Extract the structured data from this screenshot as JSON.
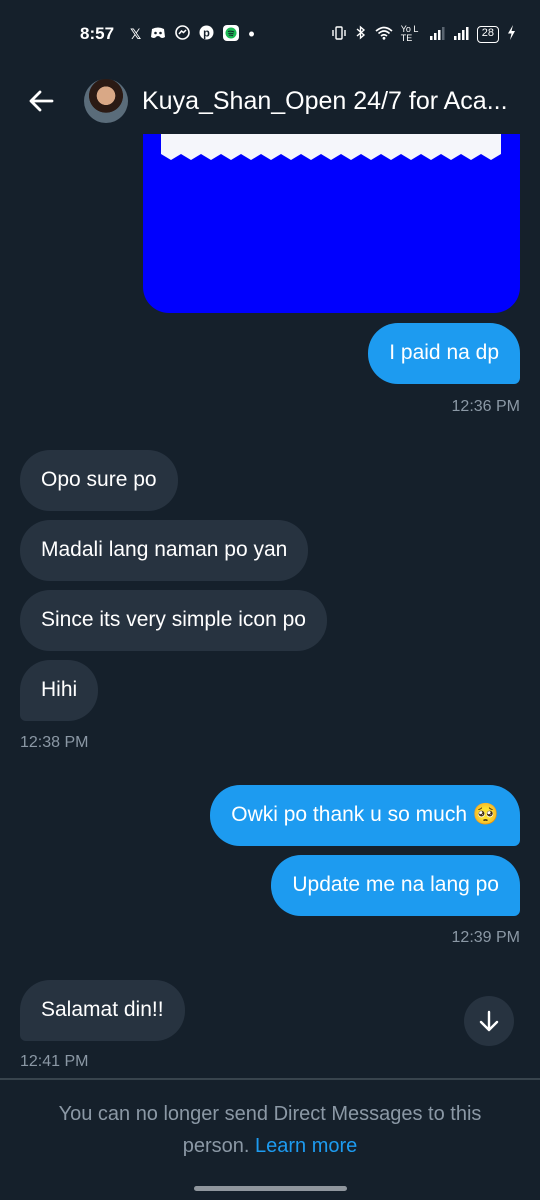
{
  "status_bar": {
    "time": "8:57",
    "left_icons": [
      "x-icon",
      "discord-icon",
      "messenger-icon",
      "pinterest-icon",
      "spotify-icon",
      "dot-icon"
    ],
    "network_label": "Yo LTE",
    "battery": "28"
  },
  "header": {
    "title": "Kuya_Shan_Open 24/7 for Aca..."
  },
  "messages": [
    {
      "id": "m1",
      "side": "sent",
      "text": "I paid na dp"
    },
    {
      "id": "t1",
      "type": "timestamp",
      "text": "12:36 PM"
    },
    {
      "id": "m2",
      "side": "received",
      "text": "Opo sure po"
    },
    {
      "id": "m3",
      "side": "received",
      "text": "Madali lang naman po yan"
    },
    {
      "id": "m4",
      "side": "received",
      "text": "Since its very simple icon po"
    },
    {
      "id": "m5",
      "side": "received",
      "text": "Hihi"
    },
    {
      "id": "t2",
      "type": "timestamp",
      "text": "12:38 PM"
    },
    {
      "id": "m6",
      "side": "sent",
      "text": "Owki po thank u so much 🥺"
    },
    {
      "id": "m7",
      "side": "sent",
      "text": "Update me na lang po"
    },
    {
      "id": "t3",
      "type": "timestamp",
      "text": "12:39 PM"
    },
    {
      "id": "m8",
      "side": "received",
      "text": "Salamat din!!"
    },
    {
      "id": "t4",
      "type": "timestamp",
      "text": "12:41 PM"
    }
  ],
  "footer": {
    "notice": "You can no longer send Direct Messages to this person.",
    "learn_more": "Learn more"
  },
  "colors": {
    "background": "#15202b",
    "sent_bubble": "#1d9bf0",
    "received_bubble": "#273340",
    "secondary_text": "#8b98a5",
    "attachment": "#0000fe"
  }
}
